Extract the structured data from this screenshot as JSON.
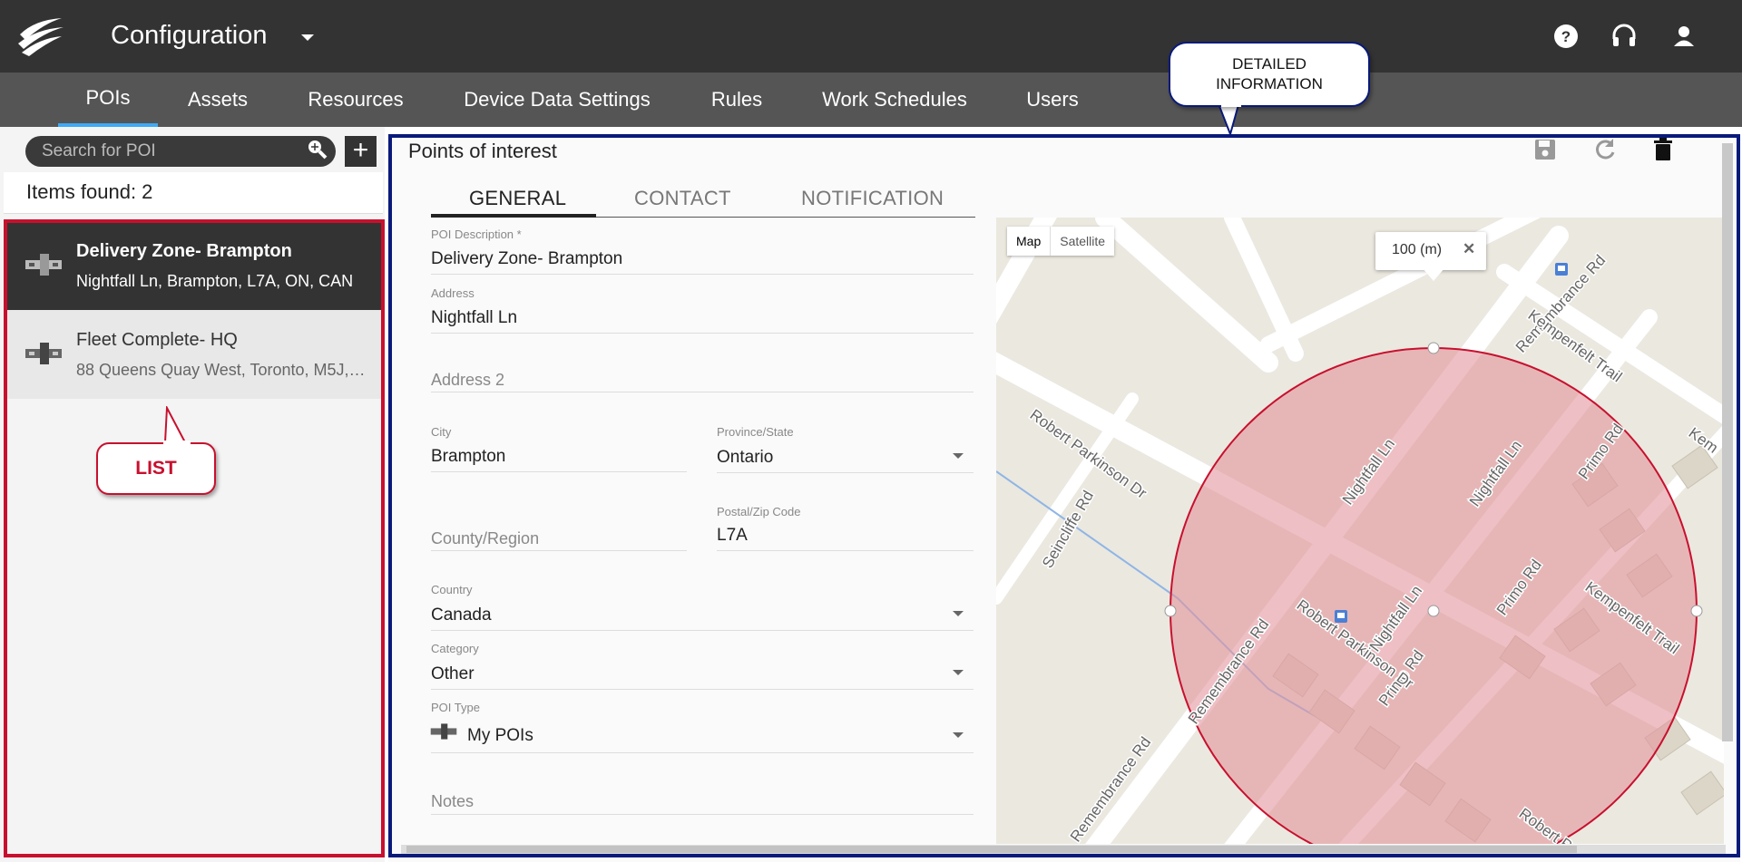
{
  "app": {
    "title": "Configuration"
  },
  "nav": {
    "tabs": [
      {
        "label": "POIs"
      },
      {
        "label": "Assets"
      },
      {
        "label": "Resources"
      },
      {
        "label": "Device Data Settings"
      },
      {
        "label": "Rules"
      },
      {
        "label": "Work Schedules"
      },
      {
        "label": "Users"
      }
    ]
  },
  "sidebar": {
    "search_placeholder": "Search for POI",
    "add_label": "+",
    "items_found": "Items found: 2",
    "items": [
      {
        "title": "Delivery Zone- Brampton",
        "subtitle": "Nightfall Ln, Brampton, L7A, ON, CAN",
        "selected": true
      },
      {
        "title": "Fleet Complete- HQ",
        "subtitle": "88 Queens Quay West, Toronto, M5J, ...",
        "selected": false
      }
    ]
  },
  "callouts": {
    "list": "LIST",
    "detail": "DETAILED INFORMATION"
  },
  "main": {
    "title": "Points of interest",
    "tabs": [
      {
        "label": "GENERAL"
      },
      {
        "label": "CONTACT"
      },
      {
        "label": "NOTIFICATION"
      }
    ],
    "fields": {
      "description": {
        "label": "POI Description *",
        "value": "Delivery Zone- Brampton"
      },
      "address": {
        "label": "Address",
        "value": "Nightfall Ln"
      },
      "address2": {
        "placeholder": "Address 2"
      },
      "city": {
        "label": "City",
        "value": "Brampton"
      },
      "province": {
        "label": "Province/State",
        "value": "Ontario"
      },
      "county": {
        "placeholder": "County/Region"
      },
      "postal": {
        "label": "Postal/Zip Code",
        "value": "L7A"
      },
      "country": {
        "label": "Country",
        "value": "Canada"
      },
      "category": {
        "label": "Category",
        "value": "Other"
      },
      "poi_type": {
        "label": "POI Type",
        "value": "My POIs"
      },
      "notes": {
        "placeholder": "Notes"
      }
    }
  },
  "map": {
    "type_buttons": [
      "Map",
      "Satellite"
    ],
    "radius_label": "100 (m)",
    "close_label": "✕",
    "street_labels": [
      "Remembrance Rd",
      "Kempenfelt Trail",
      "Robert Parkinson Dr",
      "Seincliffe Rd",
      "Nightfall Ln",
      "Primo Rd",
      "Robert Park",
      "Kem"
    ],
    "circle_color": "#e8a0a8"
  },
  "colors": {
    "accent": "#3fa9f5",
    "list_outline": "#c8102e",
    "detail_outline": "#0a1a7a",
    "topbar": "#333333"
  }
}
